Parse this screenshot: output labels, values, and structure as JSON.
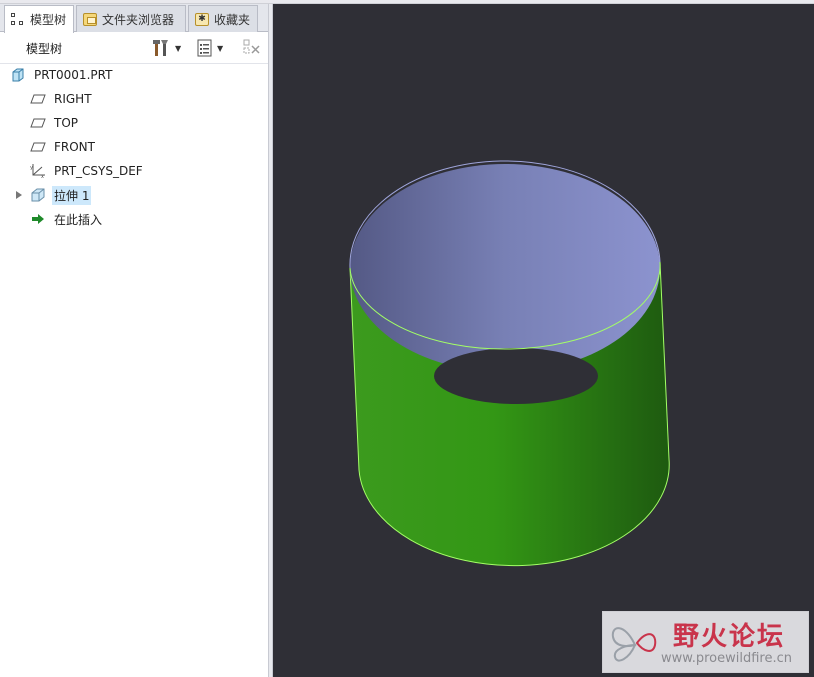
{
  "tabs": [
    {
      "label": "模型树",
      "icon": "model-tree-icon",
      "active": true
    },
    {
      "label": "文件夹浏览器",
      "icon": "folder-icon",
      "active": false
    },
    {
      "label": "收藏夹",
      "icon": "favorites-icon",
      "active": false
    }
  ],
  "toolbar": {
    "title": "模型树",
    "settings_icon": "tree-settings-icon",
    "show_icon": "show-columns-icon",
    "filter_icon": "filter-icon"
  },
  "tree": {
    "items": [
      {
        "label": "PRT0001.PRT",
        "icon": "part-icon"
      },
      {
        "label": "RIGHT",
        "icon": "datum-plane-icon"
      },
      {
        "label": "TOP",
        "icon": "datum-plane-icon"
      },
      {
        "label": "FRONT",
        "icon": "datum-plane-icon"
      },
      {
        "label": "PRT_CSYS_DEF",
        "icon": "coordinate-system-icon"
      },
      {
        "label": "拉伸 1",
        "icon": "extrude-icon",
        "selected": true,
        "expandable": true
      },
      {
        "label": "在此插入",
        "icon": "insert-here-arrow-icon"
      }
    ]
  },
  "viewport": {
    "background": "#2f2f36",
    "model_outer_color": "#2f8f1a",
    "model_inner_color": "#8088c2",
    "edge_highlight": "#9cff5a"
  },
  "watermark": {
    "title": "野火论坛",
    "url": "www.proewildfire.cn"
  }
}
